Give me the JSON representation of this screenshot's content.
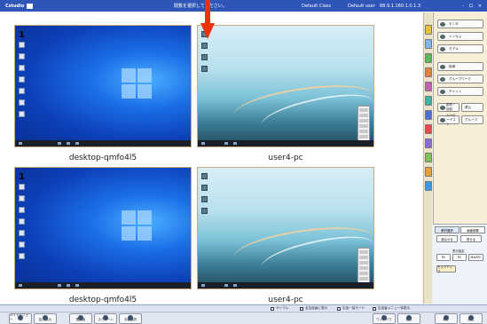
{
  "titlebar": {
    "app_name": "Cstudio",
    "message": "閲覧を選択してください。",
    "field1": "Default Class",
    "field2": "Default user",
    "field3": "88.9.1.160.1.0.1.3",
    "window_controls": "- ロ ×"
  },
  "tiles": [
    {
      "label": "desktop-qmfo4l5",
      "number": "1",
      "type": "windows"
    },
    {
      "label": "user4-pc",
      "number": "",
      "type": "desktop"
    },
    {
      "label": "desktop-qmfo4l5",
      "number": "1",
      "type": "windows"
    },
    {
      "label": "user4-pc",
      "number": "",
      "type": "desktop"
    }
  ],
  "colors": {
    "titlebar": "#2f55b8",
    "accent_arrow": "#e8320c",
    "tile_border": "#c7a97a",
    "sidebar_tabs": [
      "#e6c23a",
      "#7fb8e6",
      "#5bb85b",
      "#e0823a",
      "#c65fb3",
      "#3db3a7",
      "#4a6fd6",
      "#e84a4a",
      "#8c6bd6",
      "#7cc45a",
      "#e6a23a",
      "#3a9ae6"
    ]
  },
  "right_panel": {
    "buttons": [
      {
        "icon": "monitor-icon",
        "label": "モニタ"
      },
      {
        "icon": "intercom-icon",
        "label": "インカム"
      },
      {
        "icon": "model-icon",
        "label": "モデル"
      },
      {
        "icon": "lock-icon",
        "label": "指導"
      },
      {
        "icon": "group-icon",
        "label": "グループワーク"
      },
      {
        "icon": "chat-icon",
        "label": "チャット"
      }
    ],
    "pair_buttons": [
      {
        "icon": "send-icon",
        "label": "配布・回収"
      },
      {
        "icon": "",
        "label": "禁止"
      }
    ],
    "pair_buttons2": [
      {
        "icon": "list-icon",
        "label": "ルーピーテスト"
      },
      {
        "icon": "",
        "label": "グループ"
      }
    ],
    "lower": {
      "tab1": "教材選択",
      "tab2": "画面制御",
      "action1": "読込せる",
      "action2": "見せる",
      "section_label": "表示設定",
      "opt1": "PC",
      "opt2": "PC",
      "opt3": "MACPC",
      "extra": "モックアップ"
    }
  },
  "statusbar": {
    "check1": "サイマル",
    "check2": "全生徒画に表示",
    "check3": "生徒一括モード",
    "check4": "生徒者メニュー非表示"
  },
  "footer": {
    "buttons": [
      "メインメニュー",
      "拡大表示",
      "閲覧者",
      "スクリーン",
      "手動選択",
      "ウィンドウ",
      "送信",
      "終了",
      "設定",
      "ヘルプ"
    ]
  }
}
